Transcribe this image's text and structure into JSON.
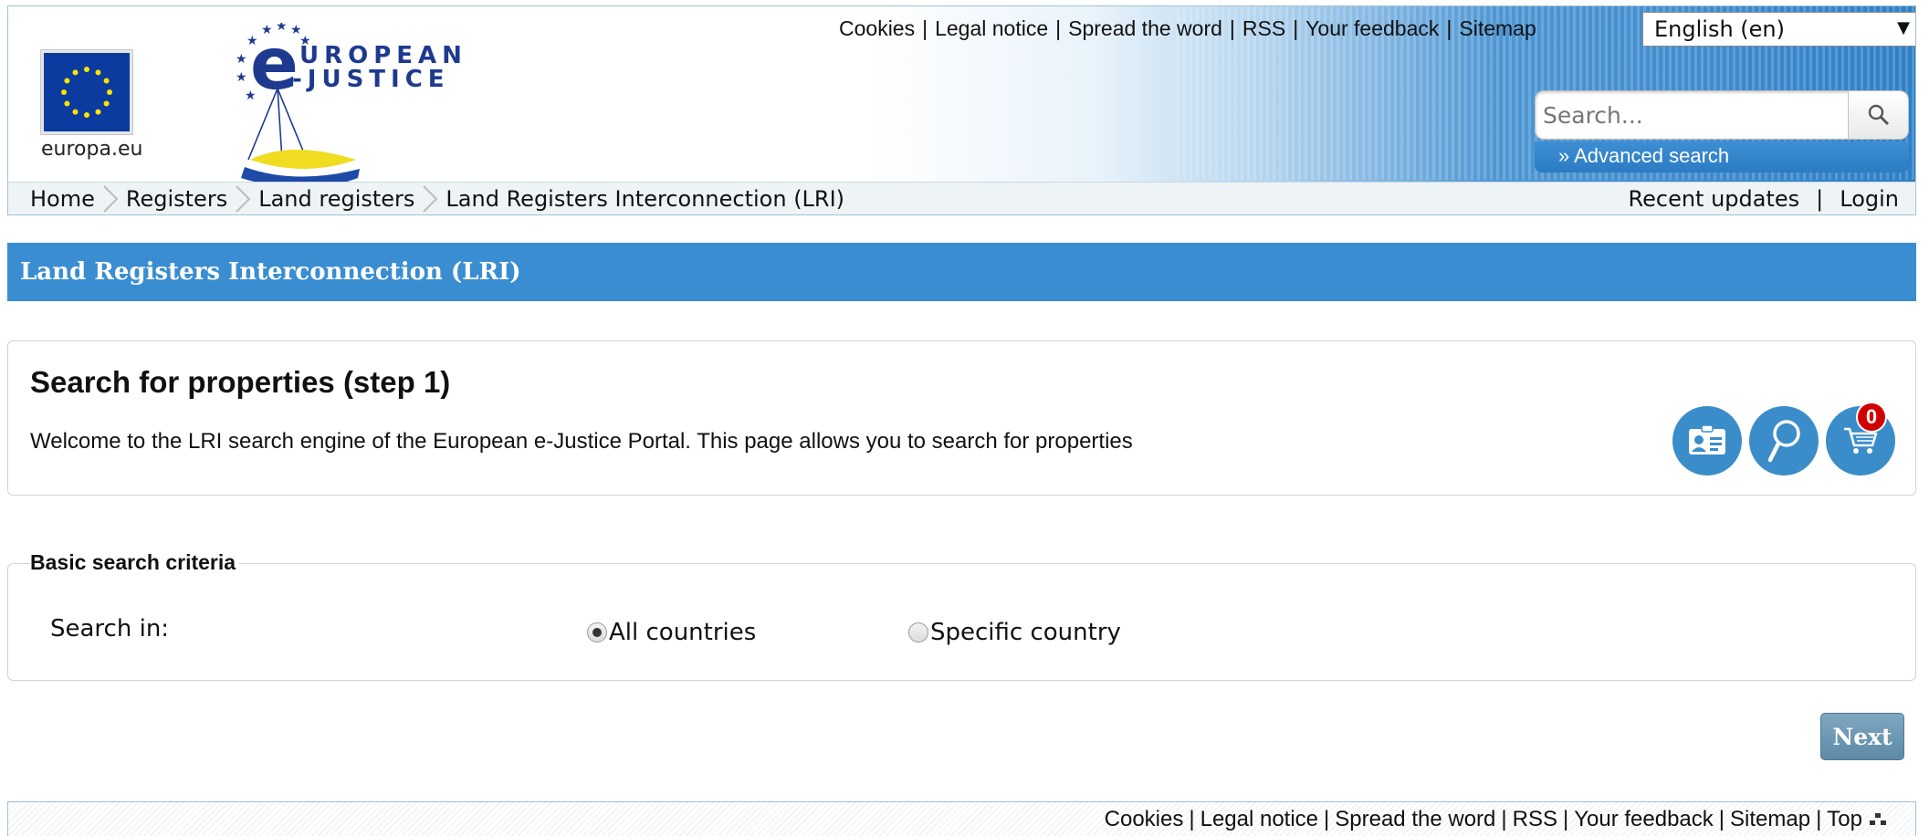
{
  "top_links": [
    "Cookies",
    "Legal notice",
    "Spread the word",
    "RSS",
    "Your feedback",
    "Sitemap"
  ],
  "language": {
    "selected": "English (en)"
  },
  "europa": {
    "caption": "europa.eu"
  },
  "portal_logo": {
    "line1": "UROPEAN",
    "line2": "-JUSTICE",
    "letter": "e"
  },
  "search": {
    "placeholder": "Search...",
    "advanced_label": "» Advanced search"
  },
  "breadcrumb": [
    "Home",
    "Registers",
    "Land registers",
    "Land Registers Interconnection (LRI)"
  ],
  "utility_links": {
    "recent_updates": "Recent updates",
    "login": "Login"
  },
  "page_title": "Land Registers Interconnection (LRI)",
  "intro": {
    "heading": "Search for properties (step 1)",
    "text": "Welcome to the LRI search engine of the European e-Justice Portal. This page allows you to search for properties",
    "cart_count": "0",
    "icons": [
      "id-card-icon",
      "magnifier-icon",
      "cart-icon"
    ]
  },
  "criteria": {
    "legend": "Basic search criteria",
    "search_in_label": "Search in:",
    "options": [
      {
        "label": "All countries",
        "selected": true
      },
      {
        "label": "Specific country",
        "selected": false
      }
    ]
  },
  "next_label": "Next",
  "footer_links": [
    "Cookies",
    "Legal notice",
    "Spread the word",
    "RSS",
    "Your feedback",
    "Sitemap",
    "Top"
  ],
  "colors": {
    "title_bar": "#3a8dd1",
    "round_buttons": "#3a8dc9",
    "badge": "#d00000",
    "next_button": "#6d97b3"
  }
}
